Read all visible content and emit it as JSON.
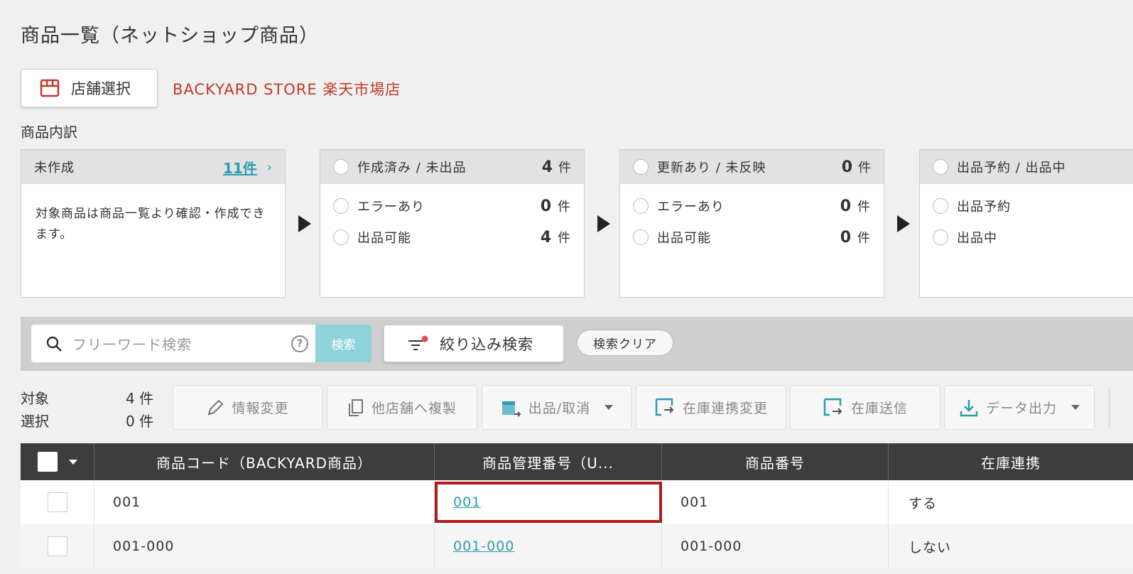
{
  "page": {
    "title": "商品一覧（ネットショップ商品）"
  },
  "store": {
    "button_label": "店舗選択",
    "name": "BACKYARD STORE 楽天市場店"
  },
  "breakdown": {
    "label": "商品内訳",
    "cards": [
      {
        "title": "未作成",
        "count_link": "11件",
        "description": "対象商品は商品一覧より確認・作成できます。"
      },
      {
        "title": "作成済み / 未出品",
        "count": "4",
        "unit": "件",
        "rows": [
          {
            "label": "エラーあり",
            "count": "0",
            "unit": "件"
          },
          {
            "label": "出品可能",
            "count": "4",
            "unit": "件"
          }
        ]
      },
      {
        "title": "更新あり / 未反映",
        "count": "0",
        "unit": "件",
        "rows": [
          {
            "label": "エラーあり",
            "count": "0",
            "unit": "件"
          },
          {
            "label": "出品可能",
            "count": "0",
            "unit": "件"
          }
        ]
      },
      {
        "title": "出品予約 / 出品中",
        "rows": [
          {
            "label": "出品予約"
          },
          {
            "label": "出品中"
          }
        ]
      }
    ]
  },
  "search": {
    "placeholder": "フリーワード検索",
    "search_button": "検索",
    "filter_button": "絞り込み検索",
    "clear_button": "検索クリア",
    "accent": "#8fd3da",
    "filter_dot_color": "#e05050"
  },
  "selection": {
    "target_label": "対象",
    "target_count": "4 件",
    "selected_label": "選択",
    "selected_count": "0 件"
  },
  "toolbar": {
    "edit_info": "情報変更",
    "copy_store": "他店舗へ複製",
    "publish": "出品/取消",
    "stock_link_change": "在庫連携変更",
    "stock_send": "在庫送信",
    "data_export": "データ出力"
  },
  "table": {
    "columns": [
      "商品コード（BACKYARD商品）",
      "商品管理番号（U...",
      "商品番号",
      "在庫連携"
    ],
    "rows": [
      {
        "code": "001",
        "manage_no": "001",
        "product_no": "001",
        "stock_link": "する"
      },
      {
        "code": "001-000",
        "manage_no": "001-000",
        "product_no": "001-000",
        "stock_link": "しない"
      }
    ]
  },
  "colors": {
    "brand_red": "#c0392b",
    "link": "#2a9db0",
    "highlight": "#b0191e",
    "header_bg": "#3d3d3d"
  }
}
